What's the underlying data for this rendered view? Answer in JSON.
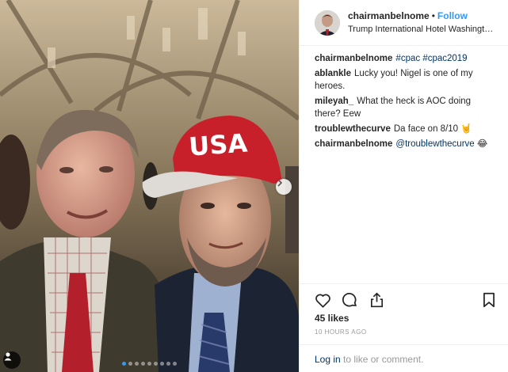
{
  "post": {
    "username": "chairmanbelnome",
    "separator": "•",
    "follow_label": "Follow",
    "location": "Trump International Hotel Washington, ..."
  },
  "photo": {
    "cap_text": "USA",
    "carousel_total": 9,
    "carousel_active": 1,
    "icons": {
      "next": "chevron-right-icon",
      "tag": "person-icon"
    }
  },
  "comments": [
    {
      "user": "chairmanbelnome",
      "segments": [
        {
          "text": "#cpac",
          "link": true
        },
        {
          "text": " ",
          "link": false
        },
        {
          "text": "#cpac2019",
          "link": true
        }
      ]
    },
    {
      "user": "ablankle",
      "segments": [
        {
          "text": "Lucky you! Nigel is one of my heroes.",
          "link": false
        }
      ]
    },
    {
      "user": "mileyah_",
      "segments": [
        {
          "text": "What the heck is AOC doing there? Eew",
          "link": false
        }
      ]
    },
    {
      "user": "troublewthecurve",
      "segments": [
        {
          "text": "Da face on 8/10 🤘",
          "link": false
        }
      ]
    },
    {
      "user": "chairmanbelnome",
      "segments": [
        {
          "text": "@troublewthecurve",
          "link": true
        },
        {
          "text": " 😂",
          "link": false
        }
      ]
    }
  ],
  "actions": {
    "like": "heart-icon",
    "comment": "comment-icon",
    "share": "share-icon",
    "save": "bookmark-icon"
  },
  "likes": "45 likes",
  "timestamp": "10 HOURS AGO",
  "footer": {
    "login": "Log in",
    "rest": " to like or comment."
  },
  "colors": {
    "accent": "#3897f0",
    "link": "#003569",
    "muted": "#999999",
    "cap_red": "#c8202b"
  }
}
